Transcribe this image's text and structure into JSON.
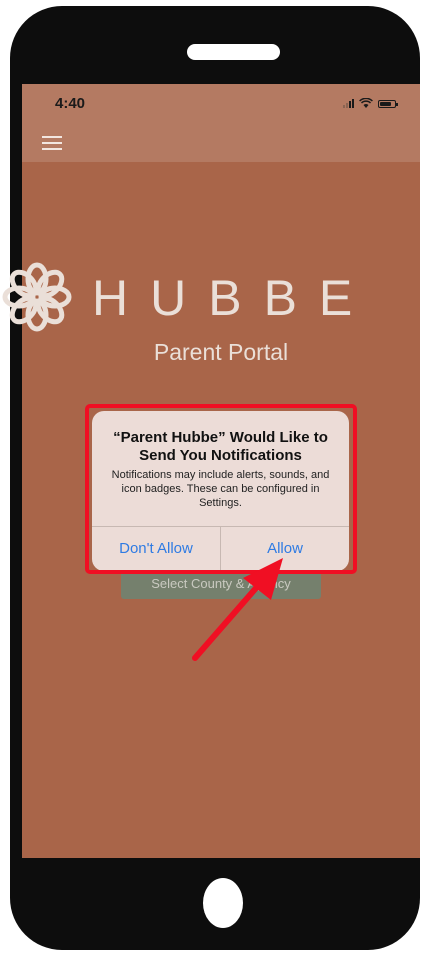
{
  "status_bar": {
    "time": "4:40"
  },
  "icons": {
    "menu": "hamburger-menu-icon",
    "logo": "flower-logo-icon",
    "signal": "cellular-signal-icon",
    "wifi": "wifi-icon",
    "battery": "battery-icon"
  },
  "brand": {
    "name": "HUBBE",
    "subtitle": "Parent Portal"
  },
  "main": {
    "select_button_label": "Select County & Agency"
  },
  "dialog": {
    "title": "“Parent Hubbe” Would Like to Send You Notifications",
    "message": "Notifications may include alerts, sounds, and icon badges. These can be configured in Settings.",
    "deny_label": "Don't Allow",
    "allow_label": "Allow"
  },
  "colors": {
    "screen_background": "#a96549",
    "highlight_annotation": "#f00f23",
    "dialog_button_text": "#2f7be3"
  }
}
